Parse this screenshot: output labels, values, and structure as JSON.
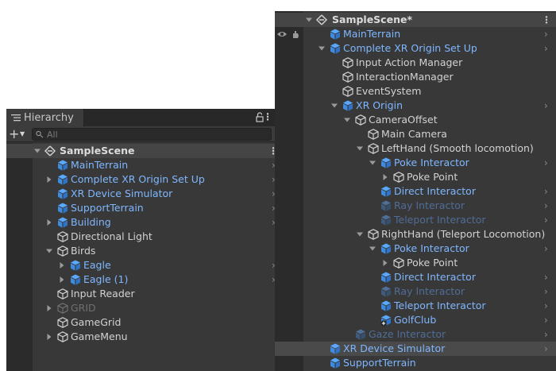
{
  "colors": {
    "panel": "#383838",
    "gutter": "#2b2b2b",
    "prefab_blue": "#7fb7ff",
    "disabled_blue": "#4f6d98",
    "text": "#d2d2d2"
  },
  "left": {
    "tab_label": "Hierarchy",
    "search_placeholder": "All",
    "scene_name": "SampleScene",
    "rows": [
      {
        "label": "MainTerrain",
        "kind": "prefab",
        "arrow": ""
      },
      {
        "label": "Complete XR Origin Set Up",
        "kind": "prefab",
        "arrow": "right"
      },
      {
        "label": "XR Device Simulator",
        "kind": "prefab",
        "arrow": ""
      },
      {
        "label": "SupportTerrain",
        "kind": "prefab",
        "arrow": ""
      },
      {
        "label": "Building",
        "kind": "prefab",
        "arrow": "right"
      },
      {
        "label": "Directional Light",
        "kind": "object",
        "arrow": ""
      },
      {
        "label": "Birds",
        "kind": "object",
        "arrow": "down"
      },
      {
        "label": "Eagle",
        "kind": "prefab",
        "arrow": "right"
      },
      {
        "label": "Eagle (1)",
        "kind": "prefab",
        "arrow": "right"
      },
      {
        "label": "Input Reader",
        "kind": "object",
        "arrow": ""
      },
      {
        "label": "GRID",
        "kind": "object-disabled",
        "arrow": "right"
      },
      {
        "label": "GameGrid",
        "kind": "object",
        "arrow": ""
      },
      {
        "label": "GameMenu",
        "kind": "object",
        "arrow": "right"
      }
    ]
  },
  "right": {
    "scene_name": "SampleScene*",
    "rows": [
      {
        "label": "MainTerrain",
        "kind": "prefab",
        "arrow": ""
      },
      {
        "label": "Complete XR Origin Set Up",
        "kind": "prefab",
        "arrow": "down"
      },
      {
        "label": "Input Action Manager",
        "kind": "object",
        "arrow": ""
      },
      {
        "label": "InteractionManager",
        "kind": "object",
        "arrow": ""
      },
      {
        "label": "EventSystem",
        "kind": "object",
        "arrow": ""
      },
      {
        "label": "XR Origin",
        "kind": "prefab",
        "arrow": "down"
      },
      {
        "label": "CameraOffset",
        "kind": "object",
        "arrow": "down"
      },
      {
        "label": "Main Camera",
        "kind": "object",
        "arrow": ""
      },
      {
        "label": "LeftHand (Smooth locomotion)",
        "kind": "object",
        "arrow": "down"
      },
      {
        "label": "Poke Interactor",
        "kind": "prefab",
        "arrow": "down"
      },
      {
        "label": "Poke Point",
        "kind": "object",
        "arrow": "right"
      },
      {
        "label": "Direct Interactor",
        "kind": "prefab",
        "arrow": ""
      },
      {
        "label": "Ray Interactor",
        "kind": "prefab-disabled",
        "arrow": ""
      },
      {
        "label": "Teleport Interactor",
        "kind": "prefab-disabled",
        "arrow": ""
      },
      {
        "label": "RightHand (Teleport Locomotion)",
        "kind": "object",
        "arrow": "down"
      },
      {
        "label": "Poke Interactor",
        "kind": "prefab",
        "arrow": "down"
      },
      {
        "label": "Poke Point",
        "kind": "object",
        "arrow": "right"
      },
      {
        "label": "Direct Interactor",
        "kind": "prefab",
        "arrow": ""
      },
      {
        "label": "Ray Interactor",
        "kind": "prefab-disabled",
        "arrow": ""
      },
      {
        "label": "Teleport Interactor",
        "kind": "prefab",
        "arrow": ""
      },
      {
        "label": "GolfClub",
        "kind": "prefab-added",
        "arrow": ""
      },
      {
        "label": "Gaze Interactor",
        "kind": "prefab-disabled",
        "arrow": ""
      },
      {
        "label": "XR Device Simulator",
        "kind": "prefab",
        "arrow": ""
      },
      {
        "label": "SupportTerrain",
        "kind": "prefab",
        "arrow": ""
      }
    ]
  }
}
